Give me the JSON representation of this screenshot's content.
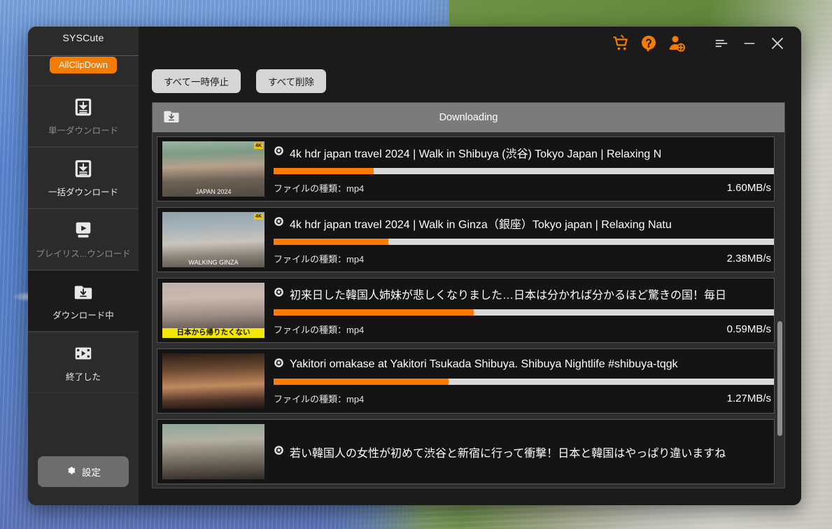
{
  "app": {
    "brand_name": "SYSCute",
    "brand_badge": "AllClipDown"
  },
  "titlebar": {
    "buttons": [
      {
        "name": "cart-icon",
        "label": "Cart"
      },
      {
        "name": "help-icon",
        "label": "Help"
      },
      {
        "name": "add-user-icon",
        "label": "Add user"
      },
      {
        "name": "menu-icon",
        "label": "Menu"
      },
      {
        "name": "minimize-icon",
        "label": "Minimize"
      },
      {
        "name": "close-icon",
        "label": "Close"
      }
    ]
  },
  "sidebar": {
    "items": [
      {
        "label": "単一ダウンロード",
        "icon": "download-box-icon",
        "active": false,
        "dim": true
      },
      {
        "label": "一括ダウンロード",
        "icon": "download-box-icon",
        "active": false,
        "dim": false
      },
      {
        "label": "プレイリス...ウンロード",
        "icon": "playlist-icon",
        "active": false,
        "dim": true
      },
      {
        "label": "ダウンロード中",
        "icon": "downloading-folder-icon",
        "active": true,
        "dim": false
      },
      {
        "label": "終了した",
        "icon": "film-icon",
        "active": false,
        "dim": false
      }
    ],
    "settings_label": "設定"
  },
  "toolbar": {
    "pause_all_label": "すべて一時停止",
    "delete_all_label": "すべて削除"
  },
  "list": {
    "header_title": "Downloading",
    "header_icon": "downloading-folder-icon",
    "file_type_label": "ファイルの種類：mp4",
    "rows": [
      {
        "title": "4k hdr japan travel 2024  |  Walk in Shibuya (渋谷) Tokyo Japan  |  Relaxing N",
        "file_type": "ファイルの種類：mp4",
        "speed": "1.60MB/s",
        "progress": 20,
        "thumb_caption": "JAPAN 2024",
        "thumb_badge": "4K",
        "caption_style": "plain"
      },
      {
        "title": "4k hdr japan travel 2024  |  Walk in Ginza（銀座）Tokyo japan  |  Relaxing Natu",
        "file_type": "ファイルの種類：mp4",
        "speed": "2.38MB/s",
        "progress": 23,
        "thumb_caption": "WALKING GINZA",
        "thumb_badge": "4K",
        "caption_style": "plain"
      },
      {
        "title": "初来日した韓国人姉妹が悲しくなりました…日本は分かれば分かるほど驚きの国！毎日",
        "file_type": "ファイルの種類：mp4",
        "speed": "0.59MB/s",
        "progress": 40,
        "thumb_caption": "日本から帰りたくない",
        "thumb_badge": "",
        "caption_style": "yellow"
      },
      {
        "title": "Yakitori omakase at Yakitori Tsukada Shibuya. Shibuya Nightlife #shibuya-tqgk",
        "file_type": "ファイルの種類：mp4",
        "speed": "1.27MB/s",
        "progress": 35,
        "thumb_caption": "",
        "thumb_badge": "",
        "caption_style": "plain"
      },
      {
        "title": "若い韓国人の女性が初めて渋谷と新宿に行って衝撃！日本と韓国はやっぱり違いますね",
        "file_type": "",
        "speed": "",
        "progress": 0,
        "thumb_caption": "",
        "thumb_badge": "",
        "caption_style": "plain"
      }
    ]
  },
  "colors": {
    "accent_orange": "#f57c00",
    "progress_orange": "#ff7a00",
    "window_bg": "#1b1b1b",
    "sidebar_bg": "#2b2b2b",
    "list_header_gray": "#7b7b7b"
  }
}
